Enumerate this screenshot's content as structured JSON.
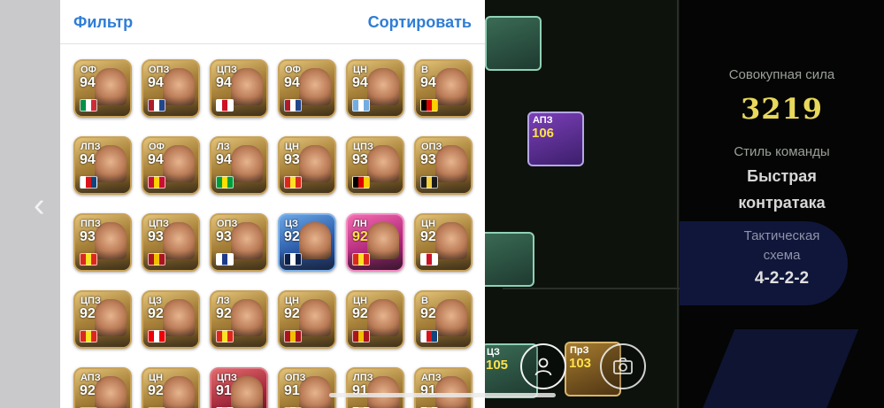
{
  "panel": {
    "filter_label": "Фильтр",
    "sort_label": "Сортировать"
  },
  "cards": [
    {
      "pos": "ОФ",
      "rating": "94",
      "style": "gold",
      "flag": [
        "#009246",
        "#ffffff",
        "#ce2b37"
      ]
    },
    {
      "pos": "ОПЗ",
      "rating": "94",
      "style": "gold",
      "flag": [
        "#ae1c28",
        "#ffffff",
        "#21468b"
      ]
    },
    {
      "pos": "ЦПЗ",
      "rating": "94",
      "style": "gold",
      "flag": [
        "#ffffff",
        "#ce1124",
        "#ffffff"
      ]
    },
    {
      "pos": "ОФ",
      "rating": "94",
      "style": "gold",
      "flag": [
        "#ae1c28",
        "#ffffff",
        "#21468b"
      ]
    },
    {
      "pos": "ЦН",
      "rating": "94",
      "style": "gold",
      "flag": [
        "#74acdf",
        "#ffffff",
        "#74acdf"
      ]
    },
    {
      "pos": "В",
      "rating": "94",
      "style": "gold",
      "flag": [
        "#000000",
        "#dd0000",
        "#ffce00"
      ]
    },
    {
      "pos": "ЛПЗ",
      "rating": "94",
      "style": "gold",
      "flag": [
        "#ffffff",
        "#d7141a",
        "#11457e"
      ]
    },
    {
      "pos": "ОФ",
      "rating": "94",
      "style": "gold",
      "flag": [
        "#c8102e",
        "#ffd100",
        "#c8102e"
      ]
    },
    {
      "pos": "ЛЗ",
      "rating": "94",
      "style": "gold",
      "flag": [
        "#009c3b",
        "#ffdf00",
        "#009c3b"
      ]
    },
    {
      "pos": "ЦН",
      "rating": "93",
      "style": "gold",
      "flag": [
        "#da291c",
        "#fbe122",
        "#da291c"
      ]
    },
    {
      "pos": "ЦПЗ",
      "rating": "93",
      "style": "gold",
      "flag": [
        "#000000",
        "#dd0000",
        "#ffce00"
      ]
    },
    {
      "pos": "ОПЗ",
      "rating": "93",
      "style": "gold",
      "flag": [
        "#1a1a1a",
        "#f4d03f",
        "#1a1a1a"
      ]
    },
    {
      "pos": "ППЗ",
      "rating": "93",
      "style": "gold",
      "flag": [
        "#da291c",
        "#fbe122",
        "#da291c"
      ]
    },
    {
      "pos": "ЦПЗ",
      "rating": "93",
      "style": "gold",
      "flag": [
        "#aa151b",
        "#f1bf00",
        "#aa151b"
      ]
    },
    {
      "pos": "ОПЗ",
      "rating": "93",
      "style": "gold",
      "flag": [
        "#ffffff",
        "#1e3a8a",
        "#ffffff"
      ]
    },
    {
      "pos": "ЦЗ",
      "rating": "92",
      "style": "blue",
      "flag": [
        "#0b1f4a",
        "#ffffff",
        "#0b1f4a"
      ]
    },
    {
      "pos": "ЛН",
      "rating": "92",
      "style": "pink",
      "flag": [
        "#da291c",
        "#fbe122",
        "#da291c"
      ]
    },
    {
      "pos": "ЦН",
      "rating": "92",
      "style": "gold",
      "flag": [
        "#ffffff",
        "#ce1124",
        "#ffffff"
      ]
    },
    {
      "pos": "ЦПЗ",
      "rating": "92",
      "style": "gold",
      "flag": [
        "#da291c",
        "#fbe122",
        "#da291c"
      ]
    },
    {
      "pos": "ЦЗ",
      "rating": "92",
      "style": "gold",
      "flag": [
        "#ef0107",
        "#ffffff",
        "#ef0107"
      ]
    },
    {
      "pos": "ЛЗ",
      "rating": "92",
      "style": "gold",
      "flag": [
        "#da291c",
        "#fbe122",
        "#da291c"
      ]
    },
    {
      "pos": "ЦН",
      "rating": "92",
      "style": "gold",
      "flag": [
        "#aa151b",
        "#f1bf00",
        "#aa151b"
      ]
    },
    {
      "pos": "ЦН",
      "rating": "92",
      "style": "gold",
      "flag": [
        "#aa151b",
        "#f1bf00",
        "#aa151b"
      ]
    },
    {
      "pos": "В",
      "rating": "92",
      "style": "gold",
      "flag": [
        "#ffffff",
        "#d7141a",
        "#11457e"
      ]
    },
    {
      "pos": "АПЗ",
      "rating": "92",
      "style": "gold",
      "flag": [
        "#a50044",
        "#004d98",
        "#a50044"
      ]
    },
    {
      "pos": "ЦН",
      "rating": "92",
      "style": "gold",
      "flag": [
        "#004d98",
        "#a50044",
        "#004d98"
      ]
    },
    {
      "pos": "ЦПЗ",
      "rating": "91",
      "style": "red",
      "flag": [
        "#ffffff",
        "#cd2e3a",
        "#ffffff"
      ]
    },
    {
      "pos": "ОПЗ",
      "rating": "91",
      "style": "gold",
      "flag": [
        "#009c3b",
        "#ffdf00",
        "#009c3b"
      ]
    },
    {
      "pos": "ЛПЗ",
      "rating": "91",
      "style": "gold",
      "flag": [
        "#ffffff",
        "#ce1124",
        "#ffffff"
      ]
    },
    {
      "pos": "АПЗ",
      "rating": "91",
      "style": "gold",
      "flag": [
        "#ffffff",
        "#ce1124",
        "#ffffff"
      ]
    }
  ],
  "pitch_cards": [
    {
      "pos": "",
      "rating": "",
      "style": "green"
    },
    {
      "pos": "АПЗ",
      "rating": "106",
      "style": "purple"
    },
    {
      "pos": "",
      "rating": "",
      "style": "green"
    },
    {
      "pos": "ЦЗ",
      "rating": "105",
      "style": "green"
    },
    {
      "pos": "ПрЗ",
      "rating": "103",
      "style": "gold"
    }
  ],
  "info": {
    "power_label": "Совокупная сила",
    "power_value": "3219",
    "style_label": "Стиль команды",
    "style_line1": "Быстрая",
    "style_line2": "контратака",
    "tactics_label_line1": "Тактическая",
    "tactics_label_line2": "схема",
    "tactics_value": "4-2-2-2"
  },
  "icons": {
    "back": "chevron-left-icon",
    "profile": "person-icon",
    "camera": "camera-icon"
  }
}
